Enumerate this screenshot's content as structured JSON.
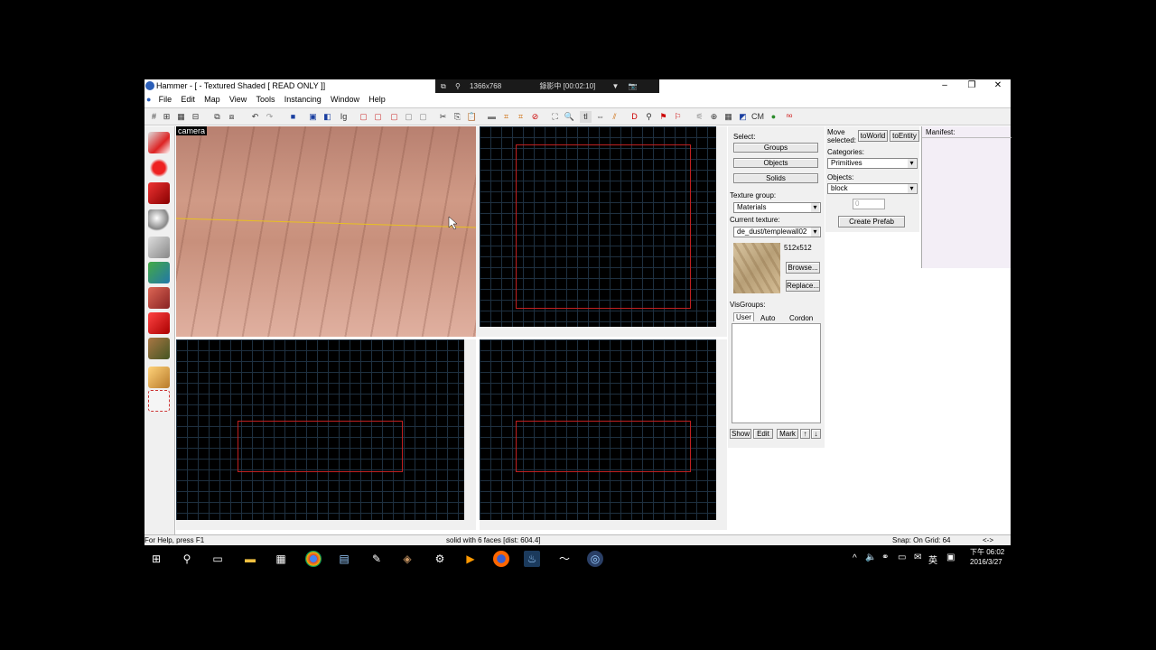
{
  "window": {
    "title": "Hammer - [ - Textured Shaded [ READ ONLY ]]",
    "recorder": {
      "resolution": "1366x768",
      "status": "錄影中 [00:02:10]"
    }
  },
  "menu": [
    "File",
    "Edit",
    "Map",
    "View",
    "Tools",
    "Instancing",
    "Window",
    "Help"
  ],
  "viewports": {
    "camera_label": "camera"
  },
  "select_panel": {
    "select_label": "Select:",
    "groups": "Groups",
    "objects": "Objects",
    "solids": "Solids",
    "texture_group_label": "Texture group:",
    "texture_group_value": "Materials",
    "current_texture_label": "Current texture:",
    "current_texture_value": "de_dust/templewall02",
    "texture_size": "512x512",
    "browse": "Browse...",
    "replace": "Replace...",
    "visgroups_label": "VisGroups:",
    "vis_tabs": [
      "User",
      "Auto",
      "Cordon"
    ],
    "vis_buttons": [
      "Show",
      "Edit",
      "Mark",
      "↑",
      "↓"
    ]
  },
  "move_panel": {
    "move_selected": "Move selected:",
    "to_world": "toWorld",
    "to_entity": "toEntity",
    "categories_label": "Categories:",
    "categories_value": "Primitives",
    "objects_label": "Objects:",
    "objects_value": "block",
    "spinner_value": "0",
    "create_prefab": "Create Prefab"
  },
  "manifest": {
    "label": "Manifest:"
  },
  "status": {
    "help": "For Help, press F1",
    "selection": "solid with 6 faces  [dist: 604.4]",
    "snap": "Snap: On Grid: 64",
    "extra": "<->"
  },
  "taskbar": {
    "time": "下午 06:02",
    "date": "2016/3/27",
    "ime": "英"
  }
}
